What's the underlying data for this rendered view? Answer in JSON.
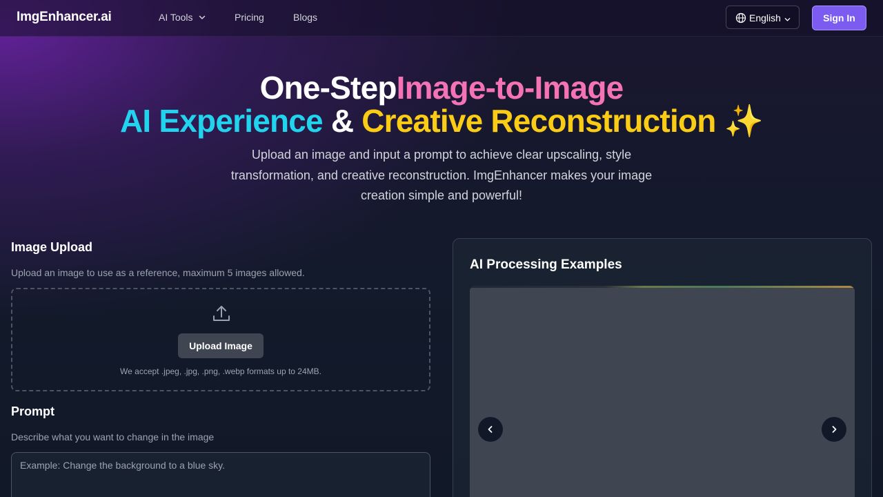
{
  "header": {
    "logo": "ImgEnhancer.ai",
    "nav": {
      "ai_tools": "AI Tools",
      "pricing": "Pricing",
      "blogs": "Blogs"
    },
    "language": "English",
    "sign_in": "Sign In"
  },
  "hero": {
    "line1_part1": "One-Step",
    "line1_part2": "Image-to-Image",
    "line2_part1": "AI Experience",
    "line2_part2": " & ",
    "line2_part3": "Creative Reconstruction",
    "line2_emoji": " ✨",
    "subtitle": "Upload an image and input a prompt to achieve clear upscaling, style transformation, and creative reconstruction. ImgEnhancer makes your image creation simple and powerful!"
  },
  "upload": {
    "title": "Image Upload",
    "description": "Upload an image to use as a reference, maximum 5 images allowed.",
    "button": "Upload Image",
    "note": "We accept .jpeg, .jpg, .png, .webp formats up to 24MB."
  },
  "prompt": {
    "title": "Prompt",
    "description": "Describe what you want to change in the image",
    "placeholder": "Example: Change the background to a blue sky."
  },
  "examples": {
    "title": "AI Processing Examples"
  },
  "colors": {
    "accent_purple": "#7c5cf0",
    "pink": "#f472b6",
    "cyan": "#22d3ee",
    "yellow": "#facc15"
  },
  "icons": {
    "nav_dropdown": "chevron-down-icon",
    "language": "globe-icon",
    "upload": "upload-icon",
    "carousel_prev": "chevron-left-icon",
    "carousel_next": "chevron-right-icon"
  }
}
